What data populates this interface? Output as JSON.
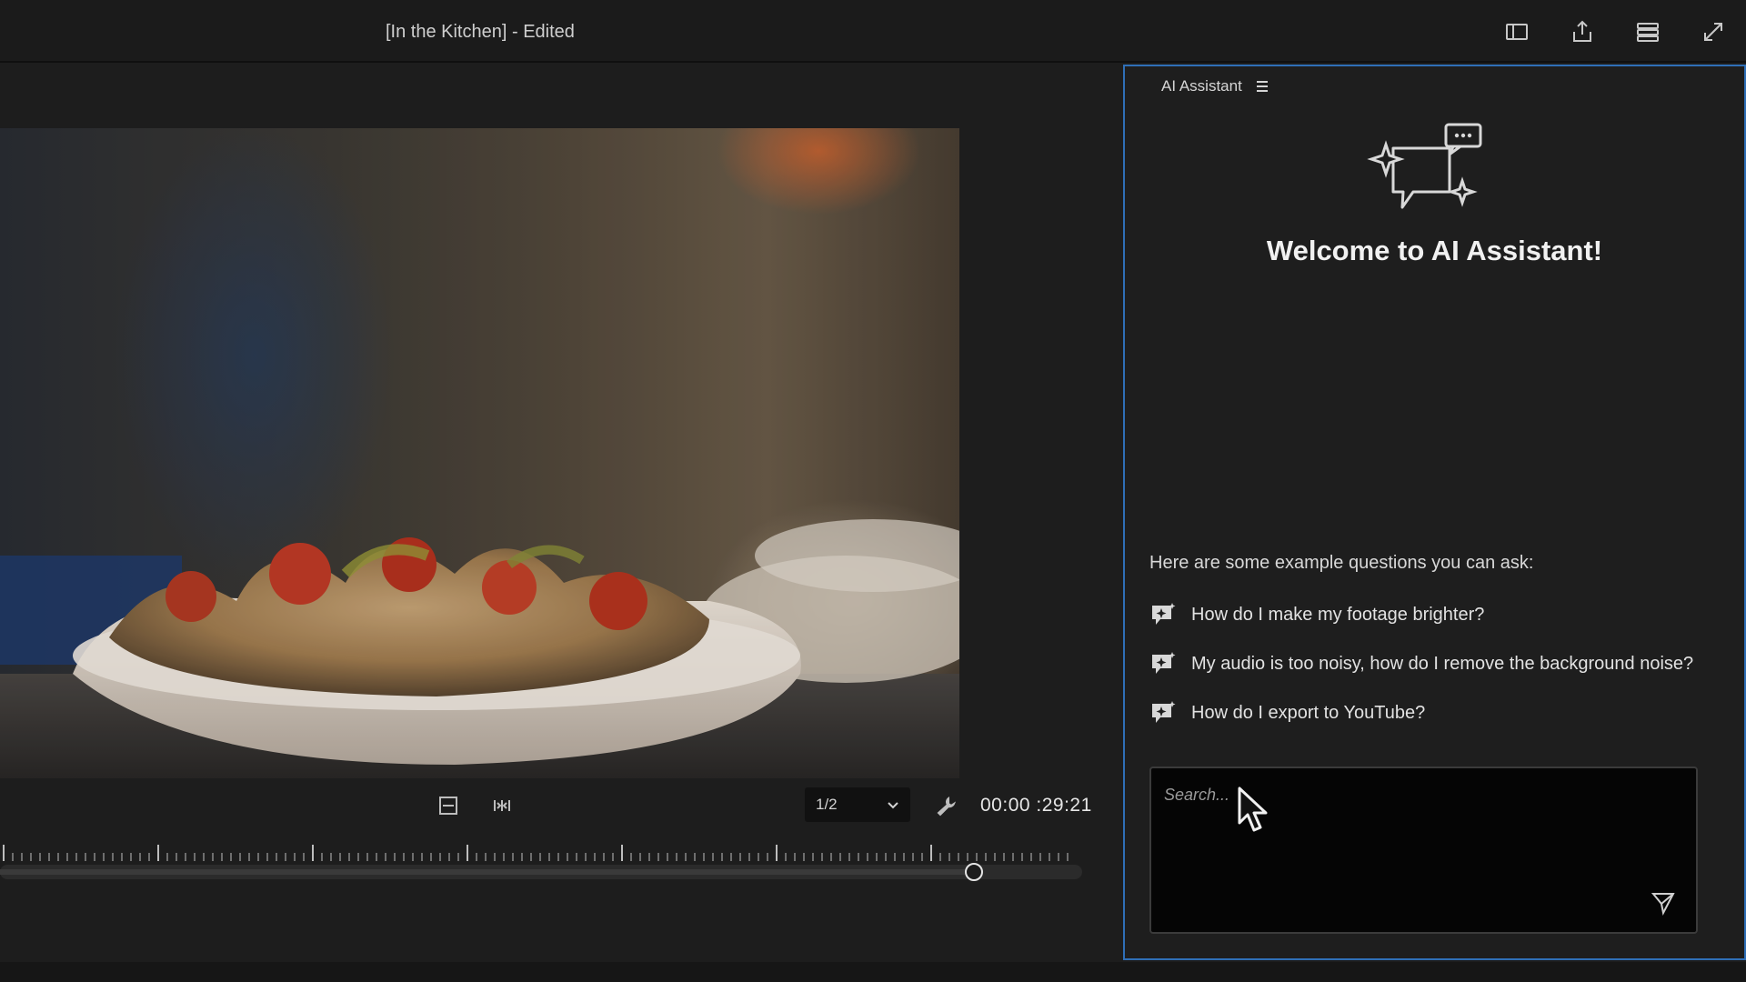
{
  "window": {
    "title": "[In the Kitchen] - Edited",
    "toolbar_icons": [
      "panel-layout-icon",
      "share-export-icon",
      "workspace-menu-icon",
      "fullscreen-icon"
    ]
  },
  "monitor": {
    "zoom_value": "1/2",
    "timecode": "00:00 :29:21",
    "playhead_fraction": 0.9,
    "transport_icons": [
      "marker-icon",
      "mark-in-icon",
      "mark-out-icon",
      "go-to-in-icon",
      "step-back-icon",
      "play-icon",
      "step-forward-icon",
      "go-to-out-icon",
      "insert-icon",
      "overwrite-icon",
      "export-frame-icon"
    ]
  },
  "ai_panel": {
    "tab_label": "AI Assistant",
    "welcome_title": "Welcome to AI Assistant!",
    "examples_intro": "Here are some example questions you can ask:",
    "examples": [
      "How do I make my footage brighter?",
      "My audio is too noisy, how do I remove the background noise?",
      "How do I export to YouTube?"
    ],
    "search_placeholder": "Search..."
  },
  "colors": {
    "panel_border": "#2f6fb7",
    "background": "#1d1d1d",
    "input_background": "#050505"
  }
}
